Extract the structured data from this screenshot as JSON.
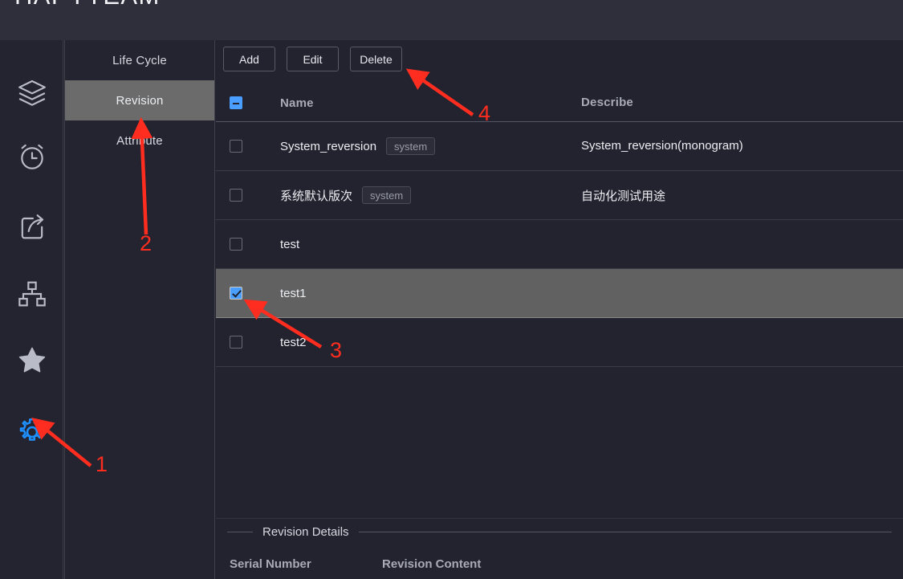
{
  "header": {
    "brand": "HAPYTEAM"
  },
  "rail": {
    "items": [
      {
        "name": "layers-icon",
        "label": "Layers"
      },
      {
        "name": "alarm-clock-icon",
        "label": "Alarm Clock"
      },
      {
        "name": "share-export-icon",
        "label": "Share"
      },
      {
        "name": "sitemap-icon",
        "label": "Sitemap"
      },
      {
        "name": "star-icon",
        "label": "Star"
      },
      {
        "name": "gear-icon",
        "label": "Settings"
      }
    ],
    "active_index": 5,
    "active_color": "#1e90ff",
    "icon_color": "#b9bcc6"
  },
  "nav": {
    "items": [
      {
        "label": "Life Cycle",
        "active": false
      },
      {
        "label": "Revision",
        "active": true
      },
      {
        "label": "Attribute",
        "active": false
      }
    ],
    "active_bg": "#6b6b6b"
  },
  "toolbar": {
    "add_label": "Add",
    "edit_label": "Edit",
    "delete_label": "Delete"
  },
  "table": {
    "columns": {
      "name": "Name",
      "describe": "Describe"
    },
    "header_checkbox_state": "indeterminate",
    "rows": [
      {
        "checked": false,
        "selected": false,
        "name": "System_reversion",
        "tag": "system",
        "describe": "System_reversion(monogram)"
      },
      {
        "checked": false,
        "selected": false,
        "name": "系统默认版次",
        "tag": "system",
        "describe": "自动化测试用途"
      },
      {
        "checked": false,
        "selected": false,
        "name": "test",
        "tag": "",
        "describe": ""
      },
      {
        "checked": true,
        "selected": true,
        "name": "test1",
        "tag": "",
        "describe": ""
      },
      {
        "checked": false,
        "selected": false,
        "name": "test2",
        "tag": "",
        "describe": ""
      }
    ]
  },
  "details": {
    "section_title": "Revision Details",
    "columns": {
      "serial_number": "Serial Number",
      "revision_content": "Revision Content"
    }
  },
  "annotations": {
    "color": "#ff2d1f",
    "markers": [
      {
        "number": "1",
        "target": "gear-icon"
      },
      {
        "number": "2",
        "target": "nav-item-revision"
      },
      {
        "number": "3",
        "target": "row-test1-checkbox"
      },
      {
        "number": "4",
        "target": "delete-button"
      }
    ]
  },
  "theme": {
    "header_bg": "#2e2f3b",
    "body_bg": "#22232e",
    "panel_bg": "#23242f",
    "selected_row_bg": "#616161",
    "accent_blue": "#4a9eff"
  }
}
